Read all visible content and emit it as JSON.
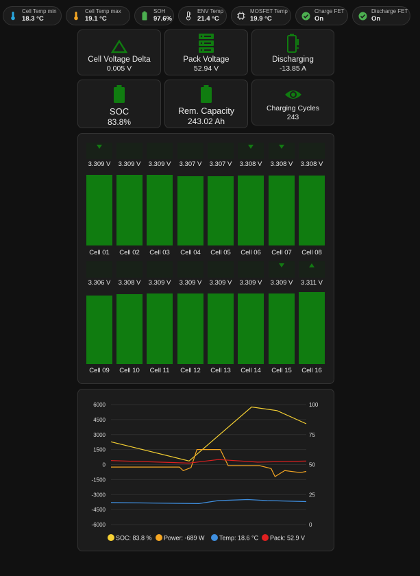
{
  "chips": [
    {
      "label": "Cell Temp min",
      "value": "18.3 °C",
      "icon": "thermometer-low-icon",
      "color": "#29a8e0"
    },
    {
      "label": "Cell Temp max",
      "value": "19.1 °C",
      "icon": "thermometer-high-icon",
      "color": "#f5a623"
    },
    {
      "label": "SOH",
      "value": "97.6%",
      "icon": "battery-icon",
      "color": "#4caf50"
    },
    {
      "label": "ENV Temp",
      "value": "21.4 °C",
      "icon": "thermometer-icon",
      "color": "#cfcfcf"
    },
    {
      "label": "MOSFET Temp",
      "value": "19.9 °C",
      "icon": "chip-icon",
      "color": "#cfcfcf"
    },
    {
      "label": "Charge FET",
      "value": "On",
      "icon": "check-circle-icon",
      "color": "#4caf50"
    },
    {
      "label": "Discharge FET",
      "value": "On",
      "icon": "check-circle-icon",
      "color": "#4caf50"
    }
  ],
  "cards": [
    {
      "name": "Cell Voltage Delta",
      "value": "0.005 V",
      "icon": "delta-icon"
    },
    {
      "name": "Pack Voltage",
      "value": "52.94 V",
      "icon": "server-stack-icon"
    },
    {
      "name": "Discharging",
      "value": "-13.85 A",
      "icon": "battery-discharging-icon"
    },
    {
      "name": "SOC",
      "value": "83.8%",
      "icon": "battery-icon"
    },
    {
      "name": "Rem. Capacity",
      "value": "243.02 Ah",
      "icon": "battery-icon"
    },
    {
      "name": "Charging Cycles",
      "value": "243",
      "icon": "eye-icon"
    }
  ],
  "accent_green": "#107c10",
  "cells": [
    {
      "name": "Cell 01",
      "voltage": "3.309 V",
      "trend": "down"
    },
    {
      "name": "Cell 02",
      "voltage": "3.309 V",
      "trend": ""
    },
    {
      "name": "Cell 03",
      "voltage": "3.309 V",
      "trend": ""
    },
    {
      "name": "Cell 04",
      "voltage": "3.307 V",
      "trend": ""
    },
    {
      "name": "Cell 05",
      "voltage": "3.307 V",
      "trend": ""
    },
    {
      "name": "Cell 06",
      "voltage": "3.308 V",
      "trend": "down"
    },
    {
      "name": "Cell 07",
      "voltage": "3.308 V",
      "trend": "down"
    },
    {
      "name": "Cell 08",
      "voltage": "3.308 V",
      "trend": ""
    },
    {
      "name": "Cell 09",
      "voltage": "3.306 V",
      "trend": ""
    },
    {
      "name": "Cell 10",
      "voltage": "3.308 V",
      "trend": ""
    },
    {
      "name": "Cell 11",
      "voltage": "3.309 V",
      "trend": ""
    },
    {
      "name": "Cell 12",
      "voltage": "3.309 V",
      "trend": ""
    },
    {
      "name": "Cell 13",
      "voltage": "3.309 V",
      "trend": ""
    },
    {
      "name": "Cell 14",
      "voltage": "3.309 V",
      "trend": ""
    },
    {
      "name": "Cell 15",
      "voltage": "3.309 V",
      "trend": "down"
    },
    {
      "name": "Cell 16",
      "voltage": "3.311 V",
      "trend": "up"
    }
  ],
  "chart": {
    "left_ticks": [
      "6000",
      "4500",
      "3000",
      "1500",
      "0",
      "-1500",
      "-3000",
      "-4500",
      "-6000"
    ],
    "right_ticks": [
      "100",
      "75",
      "50",
      "25",
      "0"
    ],
    "legend": [
      {
        "text": "SOC: 83.8 %",
        "color": "#f5d033"
      },
      {
        "text": "Power: -689 W",
        "color": "#f5a623"
      },
      {
        "text": "Temp: 18.6 °C",
        "color": "#3f8fe0"
      },
      {
        "text": "Pack: 52.9 V",
        "color": "#e02020"
      }
    ]
  },
  "chart_data": {
    "type": "line",
    "ylim": [
      -6000,
      6000
    ],
    "y2lim": [
      0,
      100
    ],
    "series": [
      {
        "name": "SOC",
        "axis": "right",
        "x": [
          0,
          0.4,
          0.72,
          0.85,
          1.0
        ],
        "values": [
          69,
          53,
          98,
          95,
          84
        ]
      },
      {
        "name": "Power",
        "axis": "left",
        "x": [
          0,
          0.35,
          0.37,
          0.41,
          0.44,
          0.56,
          0.6,
          0.76,
          0.82,
          0.84,
          0.89,
          0.97,
          1.0
        ],
        "values": [
          -250,
          -250,
          -600,
          -300,
          1500,
          1500,
          -100,
          -100,
          -400,
          -1200,
          -600,
          -800,
          -689
        ]
      },
      {
        "name": "Temp",
        "axis": "left",
        "x": [
          0,
          0.45,
          0.55,
          0.7,
          0.8,
          1.0
        ],
        "values": [
          -3800,
          -3900,
          -3600,
          -3500,
          -3600,
          -3700
        ]
      },
      {
        "name": "Pack",
        "axis": "left",
        "x": [
          0,
          0.4,
          0.55,
          0.75,
          1.0
        ],
        "values": [
          400,
          150,
          500,
          250,
          350
        ]
      }
    ]
  }
}
